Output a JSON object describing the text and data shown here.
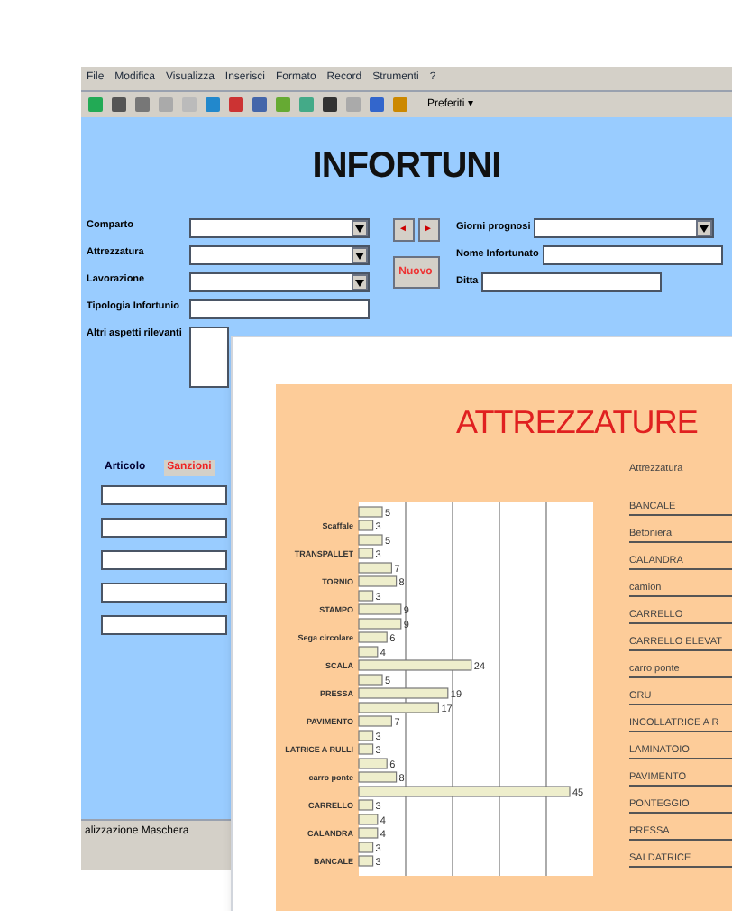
{
  "menu": [
    "File",
    "Modifica",
    "Visualizza",
    "Inserisci",
    "Formato",
    "Record",
    "Strumenti",
    "?"
  ],
  "toolbar": {
    "favorites": "Preferiti ▾"
  },
  "form": {
    "title": "INFORTUNI",
    "left_fields": [
      {
        "label": "Comparto",
        "kind": "combo"
      },
      {
        "label": "Attrezzatura",
        "kind": "combo"
      },
      {
        "label": "Lavorazione",
        "kind": "combo"
      },
      {
        "label": "Tipologia Infortunio",
        "kind": "text"
      },
      {
        "label": "Altri aspetti rilevanti",
        "kind": "memo"
      }
    ],
    "nav_buttons": [
      "◄",
      "►"
    ],
    "new_button": "Nuovo",
    "right_fields": [
      {
        "label": "Giorni prognosi",
        "kind": "combo"
      },
      {
        "label": "Nome Infortunato",
        "kind": "text"
      },
      {
        "label": "Ditta",
        "kind": "text"
      }
    ],
    "tabs": [
      {
        "label": "Articolo",
        "selected": true
      },
      {
        "label": "Sanzioni",
        "selected": false
      }
    ],
    "status_bar": "alizzazione Maschera"
  },
  "report": {
    "title": "ATTREZZATURE",
    "chart_data": {
      "type": "bar",
      "orientation": "horizontal",
      "data_labels": true,
      "categories": [
        "Scaffale",
        "TRANSPALLET",
        "TORNIO",
        "STAMPO",
        "Sega circolare",
        "SCALA",
        "PRESSA",
        "PAVIMENTO",
        "LATRICE A RULLI",
        "carro ponte",
        "CARRELLO",
        "CALANDRA",
        "BANCALE"
      ],
      "series": [
        {
          "color": "#eeeecc",
          "values": [
            5,
            5,
            7,
            3,
            9,
            4,
            5,
            17,
            3,
            6,
            45,
            4,
            3
          ]
        },
        {
          "color": "#eeeecc",
          "values": [
            3,
            3,
            8,
            9,
            6,
            24,
            19,
            7,
            3,
            8,
            3,
            4,
            3
          ]
        }
      ]
    },
    "list_header": "Attrezzatura",
    "list": [
      "BANCALE",
      "Betoniera",
      "CALANDRA",
      "camion",
      "CARRELLO",
      "CARRELLO ELEVAT",
      "carro ponte",
      "GRU",
      "INCOLLATRICE A R",
      "LAMINATOIO",
      "PAVIMENTO",
      "PONTEGGIO",
      "PRESSA",
      "SALDATRICE"
    ]
  }
}
